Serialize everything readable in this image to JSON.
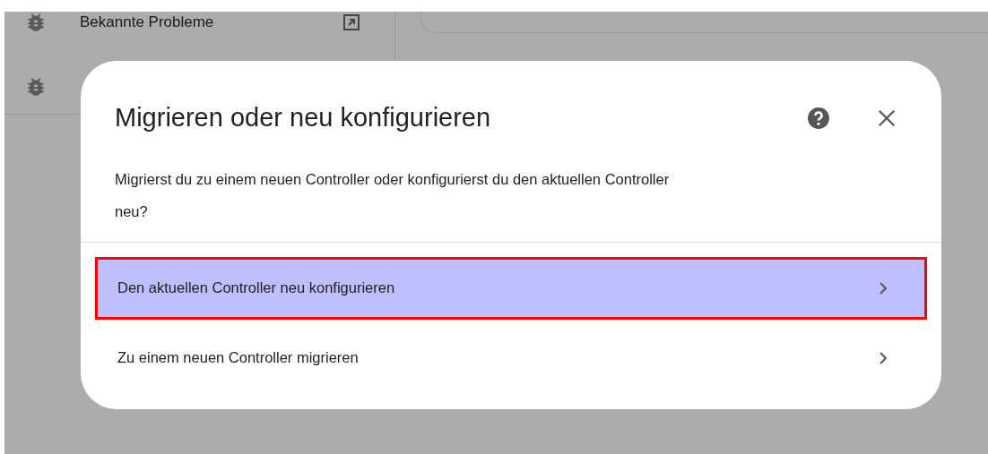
{
  "sidebar": {
    "items": [
      {
        "label": "Bekannte Probleme",
        "kind": "external"
      },
      {
        "kind": "hidden"
      }
    ]
  },
  "dialog": {
    "title": "Migrieren oder neu konfigurieren",
    "description": "Migrierst du zu einem neuen Controller oder konfigurierst du den aktuellen Controller neu?",
    "options": [
      {
        "label": "Den aktuellen Controller neu konfigurieren",
        "selected": true
      },
      {
        "label": "Zu einem neuen Controller migrieren",
        "selected": false
      }
    ]
  }
}
